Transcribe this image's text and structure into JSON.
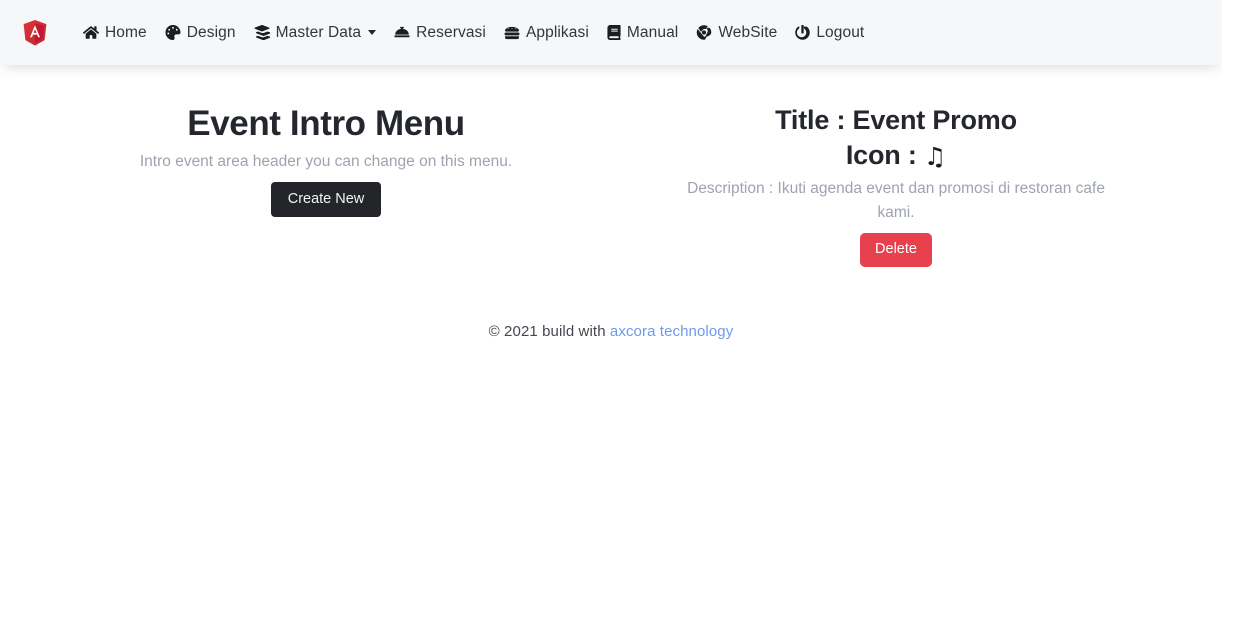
{
  "navbar": {
    "brand": {
      "icon": "angular-logo-icon",
      "alt": "Angular"
    },
    "items": [
      {
        "label": "Home",
        "icon": "home-icon",
        "has_caret": false
      },
      {
        "label": "Design",
        "icon": "palette-icon",
        "has_caret": false
      },
      {
        "label": "Master Data",
        "icon": "layer-stack-icon",
        "has_caret": true
      },
      {
        "label": "Reservasi",
        "icon": "concierge-bell-icon",
        "has_caret": false
      },
      {
        "label": "Applikasi",
        "icon": "hamburger-food-icon",
        "has_caret": false
      },
      {
        "label": "Manual",
        "icon": "book-icon",
        "has_caret": false
      },
      {
        "label": "WebSite",
        "icon": "chrome-icon",
        "has_caret": false
      },
      {
        "label": "Logout",
        "icon": "power-off-icon",
        "has_caret": false
      }
    ]
  },
  "intro": {
    "heading": "Event Intro Menu",
    "subtext": "Intro event area header you can change on this menu.",
    "create_button": "Create New"
  },
  "promo": {
    "title_line": "Title : Event Promo",
    "icon_label": "Icon : ",
    "icon_glyph": "♫",
    "icon_name": "music-note-icon",
    "description": "Description : Ikuti agenda event dan promosi di restoran cafe kami.",
    "delete_button": "Delete"
  },
  "footer": {
    "copyright": "© 2021 build with ",
    "link_text": "axcora technology"
  },
  "colors": {
    "navbar_bg": "#f6f7f9",
    "page_bg": "#ffffff",
    "heading": "#25272e",
    "muted_text": "#9ea3b0",
    "dark_button": "#232529",
    "danger_button": "#e8414e",
    "link": "#6d9beb",
    "brand_red": "#dd0031"
  }
}
